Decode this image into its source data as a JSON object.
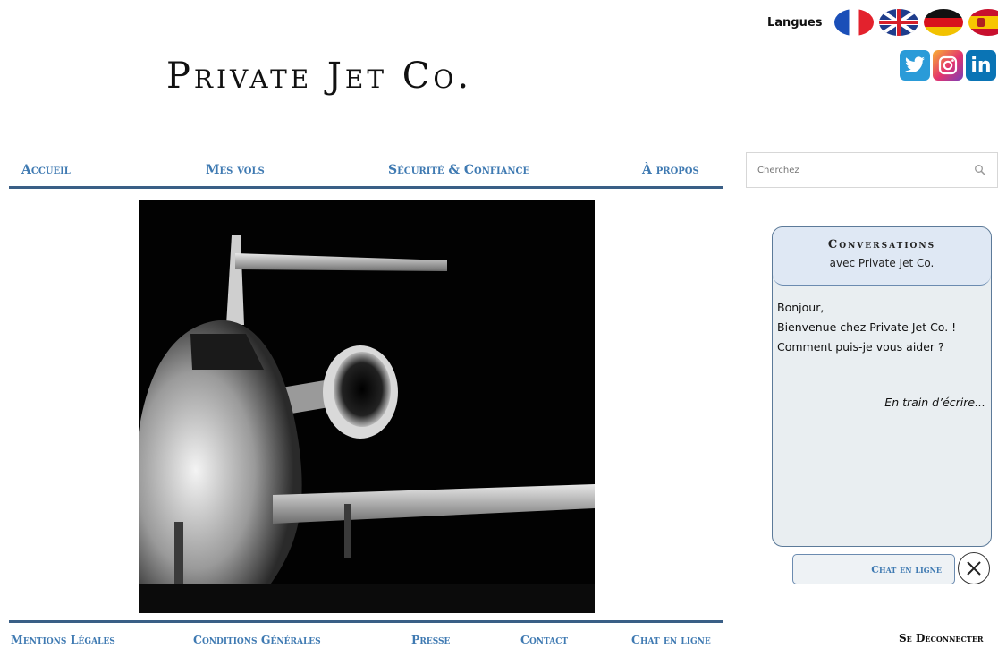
{
  "languages": {
    "label": "Langues",
    "flags": [
      "french-flag-icon",
      "uk-flag-icon",
      "german-flag-icon",
      "spanish-flag-icon"
    ]
  },
  "social": [
    "twitter-icon",
    "instagram-icon",
    "linkedin-icon"
  ],
  "logo": {
    "text": "Private Jet Co."
  },
  "nav": {
    "items": [
      {
        "label": "Accueil"
      },
      {
        "label": "Mes vols"
      },
      {
        "label": "Sécurité & Confiance"
      },
      {
        "label": "À propos"
      }
    ]
  },
  "search": {
    "placeholder": "Cherchez",
    "icon": "search-icon"
  },
  "hero": {
    "description_icon": "private-jet-photo"
  },
  "chat": {
    "title": "Conversations",
    "subtitle": "avec Private Jet Co.",
    "messages": [
      "Bonjour,",
      "Bienvenue chez Private Jet Co. !",
      "Comment puis-je vous aider ?"
    ],
    "typing": "En train d’écrire...",
    "button_label": "Chat en ligne",
    "close_icon": "close-icon"
  },
  "footer": {
    "links": [
      {
        "label": "Mentions Légales"
      },
      {
        "label": "Conditions Générales"
      },
      {
        "label": "Presse"
      },
      {
        "label": "Contact"
      },
      {
        "label": "Chat en ligne"
      }
    ],
    "logout": "Se Déconnecter"
  },
  "colors": {
    "accent": "#3f7ab2",
    "line": "#3a5f86",
    "chat_bg": "#e9eef1",
    "chat_head": "#dfe8f4"
  }
}
